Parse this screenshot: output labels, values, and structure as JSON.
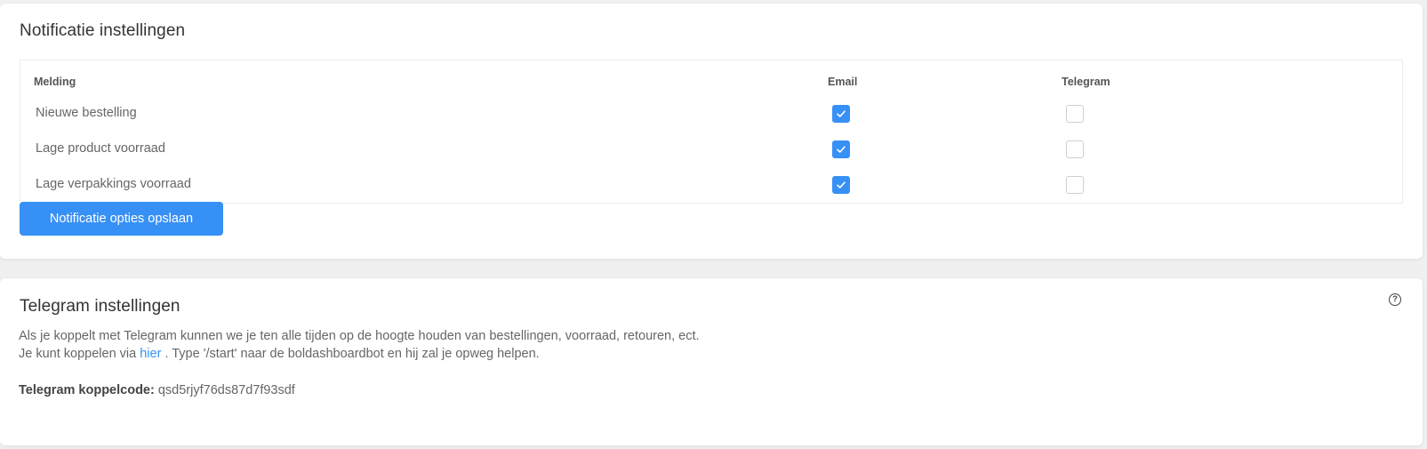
{
  "notifications": {
    "title": "Notificatie instellingen",
    "columns": {
      "melding": "Melding",
      "email": "Email",
      "telegram": "Telegram"
    },
    "rows": [
      {
        "label": "Nieuwe bestelling",
        "email": true,
        "telegram": false
      },
      {
        "label": "Lage product voorraad",
        "email": true,
        "telegram": false
      },
      {
        "label": "Lage verpakkings voorraad",
        "email": true,
        "telegram": false
      }
    ],
    "save_label": "Notificatie opties opslaan"
  },
  "telegram": {
    "title": "Telegram instellingen",
    "help_icon": "question-circle-icon",
    "help_glyph": "?",
    "line1": "Als je koppelt met Telegram kunnen we je ten alle tijden op de hoogte houden van bestellingen, voorraad, retouren, ect.",
    "line2_before": "Je kunt koppelen via",
    "line2_link": "hier",
    "line2_after": ". Type '/start' naar de boldashboardbot en hij zal je opweg helpen.",
    "code_label": "Telegram koppelcode:",
    "code_value": "qsd5rjyf76ds87d7f93sdf"
  },
  "colors": {
    "accent": "#3790f5",
    "page_bg": "#f0f0f0",
    "card_bg": "#ffffff"
  }
}
